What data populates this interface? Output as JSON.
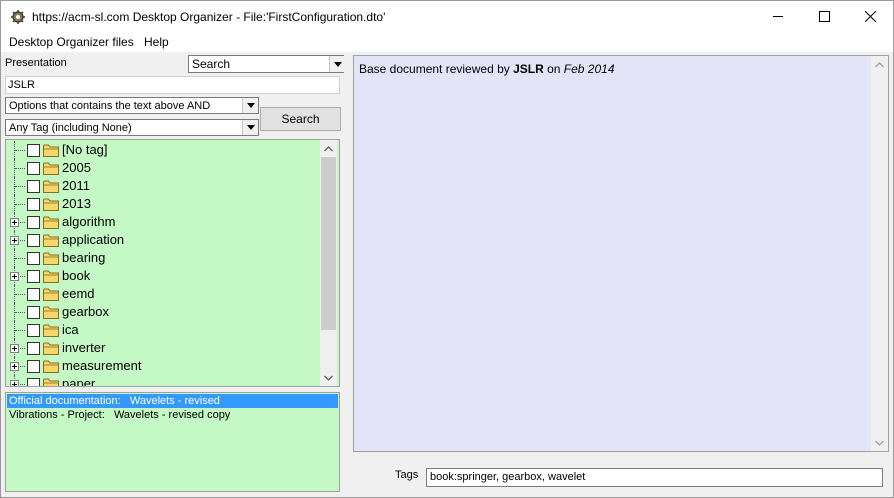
{
  "window": {
    "title": "https://acm-sl.com Desktop Organizer - File:'FirstConfiguration.dto'",
    "icons": {
      "app": "app-gear-icon",
      "minimize": "minimize-icon",
      "maximize": "maximize-icon",
      "close": "close-icon"
    }
  },
  "menu": {
    "items": [
      {
        "label": "Desktop Organizer files"
      },
      {
        "label": "Help"
      }
    ]
  },
  "filter": {
    "presentation_label": "Presentation",
    "mode_value": "Search",
    "text_value": "JSLR",
    "options_value": "Options that contains the text above AND",
    "tag_value": "Any Tag (including None)",
    "search_button": "Search"
  },
  "tree": {
    "items": [
      {
        "label": "[No tag]",
        "expandable": false
      },
      {
        "label": "2005",
        "expandable": false
      },
      {
        "label": "2011",
        "expandable": false
      },
      {
        "label": "2013",
        "expandable": false
      },
      {
        "label": "algorithm",
        "expandable": true
      },
      {
        "label": "application",
        "expandable": true
      },
      {
        "label": "bearing",
        "expandable": false
      },
      {
        "label": "book",
        "expandable": true
      },
      {
        "label": "eemd",
        "expandable": false
      },
      {
        "label": "gearbox",
        "expandable": false
      },
      {
        "label": "ica",
        "expandable": false
      },
      {
        "label": "inverter",
        "expandable": true
      },
      {
        "label": "measurement",
        "expandable": true
      },
      {
        "label": "paper",
        "expandable": true
      }
    ],
    "scroll_position": 0.0
  },
  "documents": {
    "rows": [
      {
        "text": "Official documentation:   Wavelets - revised",
        "selected": true
      },
      {
        "text": "Vibrations - Project:   Wavelets - revised copy",
        "selected": false
      }
    ]
  },
  "content": {
    "prefix": "Base document reviewed by ",
    "author": "JSLR",
    "mid": " on ",
    "date": "Feb 2014"
  },
  "tags": {
    "label": "Tags",
    "value": "book:springer, gearbox, wavelet"
  },
  "colors": {
    "tree_bg": "#c4f8c4",
    "content_bg": "#e4e4f8",
    "selection": "#3399ff",
    "folder": "#f5d76e"
  }
}
